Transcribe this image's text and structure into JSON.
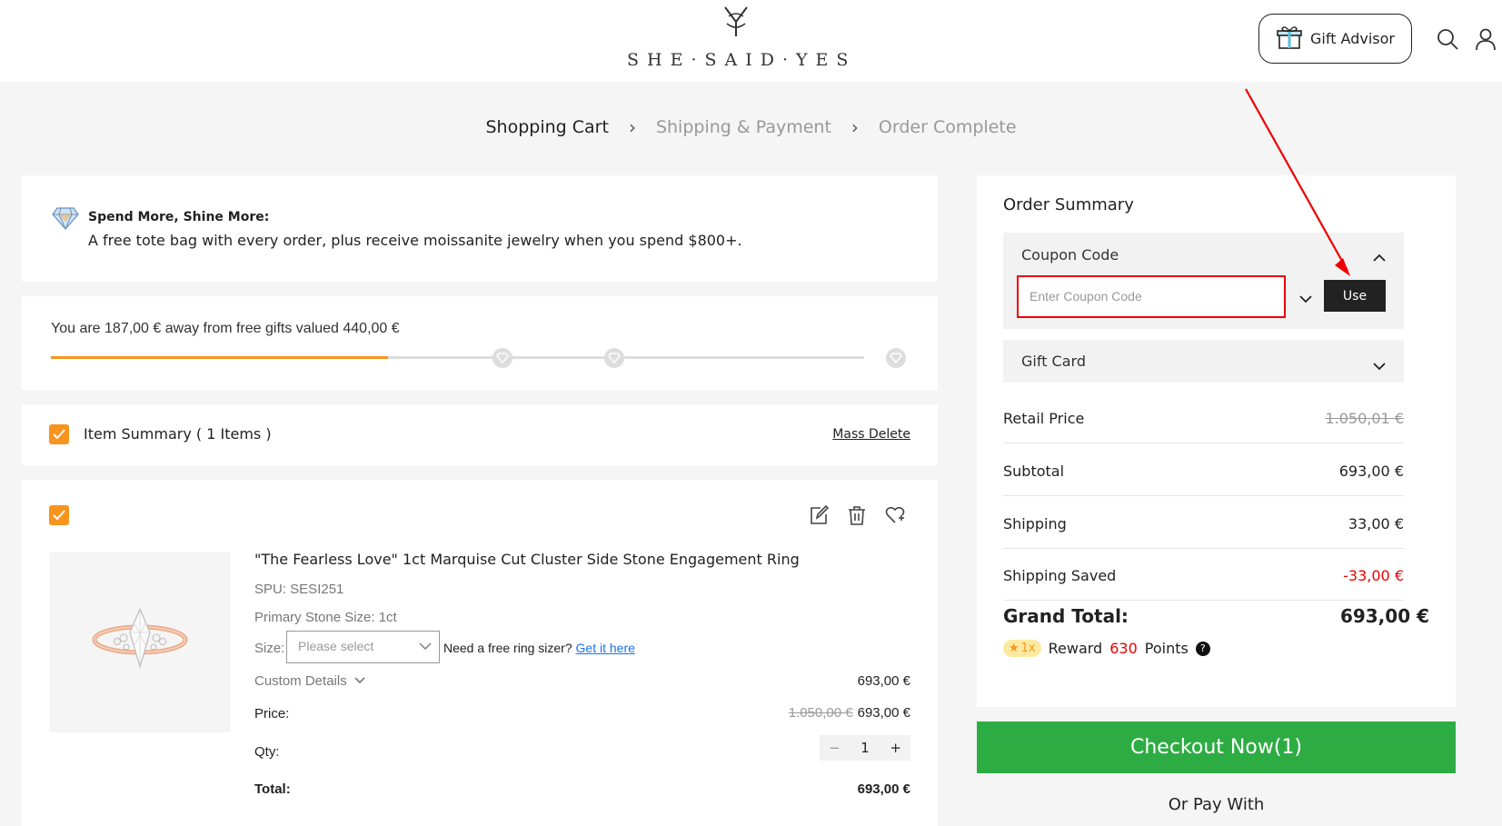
{
  "header": {
    "logo_mark": "ⴽ",
    "logo_text": "SHE·SAID·YES",
    "gift_advisor_label": "Gift Advisor"
  },
  "steps": {
    "cart": "Shopping Cart",
    "shipping": "Shipping & Payment",
    "complete": "Order Complete"
  },
  "promo": {
    "title": "Spend More, Shine More:",
    "text": "A free tote bag with every order, plus receive moissanite jewelry when you spend $800+."
  },
  "gift_progress": {
    "text": "You are 187,00 € away from free gifts valued 440,00 €",
    "progress_fraction": 0.415
  },
  "item_summary": {
    "label": "Item Summary ( 1 Items )",
    "mass_delete": "Mass Delete"
  },
  "product": {
    "title": "\"The Fearless Love\" 1ct Marquise Cut Cluster Side Stone Engagement Ring",
    "spu": "SPU: SESI251",
    "primary_stone": "Primary Stone Size: 1ct",
    "size_label": "Size:",
    "size_placeholder": "Please select",
    "sizer_text": "Need a free ring sizer?",
    "sizer_link": "Get it here",
    "custom_details": "Custom Details",
    "custom_price": "693,00 €",
    "price_label": "Price:",
    "price_original": "1.050,00 €",
    "price": "693,00 €",
    "qty_label": "Qty:",
    "qty": "1",
    "total_label": "Total:",
    "total": "693,00 €"
  },
  "order_summary": {
    "title": "Order Summary",
    "coupon_label": "Coupon Code",
    "coupon_placeholder": "Enter Coupon Code",
    "use_label": "Use",
    "gift_card_label": "Gift Card",
    "retail_label": "Retail Price",
    "retail_value": "1.050,01 €",
    "subtotal_label": "Subtotal",
    "subtotal_value": "693,00 €",
    "shipping_label": "Shipping",
    "shipping_value": "33,00 €",
    "shipping_saved_label": "Shipping Saved",
    "shipping_saved_value": "-33,00 €",
    "grand_total_label": "Grand Total:",
    "grand_total_value": "693,00 €",
    "reward_multiplier": "1x",
    "reward_prefix": "Reward",
    "reward_points": "630",
    "reward_suffix": "Points",
    "checkout_label": "Checkout Now(1)",
    "or_pay_with": "Or Pay With"
  },
  "colors": {
    "accent_orange": "#f7941d",
    "checkout_green": "#2eac44",
    "annotation_red": "#e00000"
  }
}
